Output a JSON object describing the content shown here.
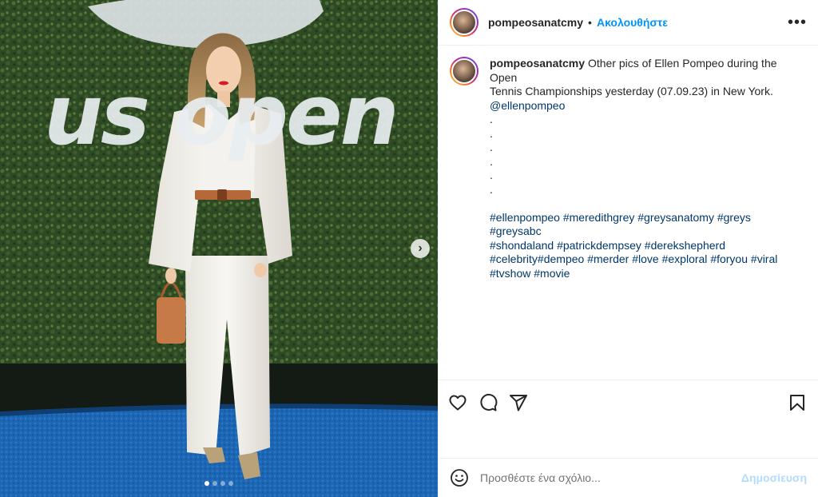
{
  "post": {
    "username": "pompeosanatcmy",
    "separator": "•",
    "follow_label": "Ακολουθήστε",
    "more_icon": "more-options-icon",
    "more_symbol": "•••",
    "next_symbol": "›"
  },
  "media": {
    "logo_text": "us open",
    "carousel_count": 4,
    "carousel_active_index": 0
  },
  "caption": {
    "username": "pompeosanatcmy",
    "text_line1": "Other pics of Ellen Pompeo during the Open",
    "text_line2": "Tennis Championships yesterday (07.09.23) in New York.",
    "mention": "@ellenpompeo",
    "dots": [
      ".",
      ".",
      ".",
      ".",
      ".",
      "."
    ],
    "hashtag_lines": [
      [
        "#ellenpompeo",
        "#meredithgrey",
        "#greysanatomy",
        "#greys",
        "#greysabc"
      ],
      [
        "#shondaland",
        "#patrickdempsey",
        "#derekshepherd"
      ],
      [
        "#celebrity",
        "#dempeo",
        "#merder",
        "#love",
        "#exploral",
        "#foryou",
        "#viral"
      ],
      [
        "#tvshow",
        "#movie"
      ]
    ]
  },
  "actions": {
    "like_icon": "heart-icon",
    "comment_icon": "comment-icon",
    "share_icon": "share-icon",
    "save_icon": "bookmark-icon"
  },
  "comment_box": {
    "placeholder": "Προσθέστε ένα σχόλιο...",
    "post_label": "Δημοσίευση",
    "emoji_icon": "emoji-icon"
  },
  "colors": {
    "accent": "#0095f6",
    "link": "#00376b",
    "post_disabled": "#b3dbff"
  }
}
